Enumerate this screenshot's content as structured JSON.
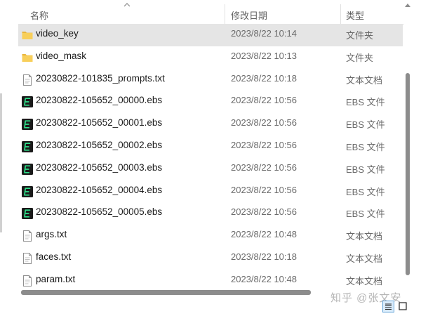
{
  "columns": {
    "name": "名称",
    "date": "修改日期",
    "type": "类型"
  },
  "sort": {
    "column": "name",
    "direction": "ascending"
  },
  "files": [
    {
      "icon": "folder-icon",
      "name": "video_key",
      "date": "2023/8/22 10:14",
      "type": "文件夹",
      "selected": true
    },
    {
      "icon": "folder-icon",
      "name": "video_mask",
      "date": "2023/8/22 10:13",
      "type": "文件夹",
      "selected": false
    },
    {
      "icon": "text-file-icon",
      "name": "20230822-101835_prompts.txt",
      "date": "2023/8/22 10:18",
      "type": "文本文档",
      "selected": false
    },
    {
      "icon": "ebs-file-icon",
      "name": "20230822-105652_00000.ebs",
      "date": "2023/8/22 10:56",
      "type": "EBS 文件",
      "selected": false
    },
    {
      "icon": "ebs-file-icon",
      "name": "20230822-105652_00001.ebs",
      "date": "2023/8/22 10:56",
      "type": "EBS 文件",
      "selected": false
    },
    {
      "icon": "ebs-file-icon",
      "name": "20230822-105652_00002.ebs",
      "date": "2023/8/22 10:56",
      "type": "EBS 文件",
      "selected": false
    },
    {
      "icon": "ebs-file-icon",
      "name": "20230822-105652_00003.ebs",
      "date": "2023/8/22 10:56",
      "type": "EBS 文件",
      "selected": false
    },
    {
      "icon": "ebs-file-icon",
      "name": "20230822-105652_00004.ebs",
      "date": "2023/8/22 10:56",
      "type": "EBS 文件",
      "selected": false
    },
    {
      "icon": "ebs-file-icon",
      "name": "20230822-105652_00005.ebs",
      "date": "2023/8/22 10:56",
      "type": "EBS 文件",
      "selected": false
    },
    {
      "icon": "text-file-icon",
      "name": "args.txt",
      "date": "2023/8/22 10:48",
      "type": "文本文档",
      "selected": false
    },
    {
      "icon": "text-file-icon",
      "name": "faces.txt",
      "date": "2023/8/22 10:18",
      "type": "文本文档",
      "selected": false
    },
    {
      "icon": "text-file-icon",
      "name": "param.txt",
      "date": "2023/8/22 10:48",
      "type": "文本文档",
      "selected": false
    }
  ],
  "watermark": "知乎 @张文安",
  "colors": {
    "selection": "#e5e5e5",
    "folder": "#f5c84c",
    "ebs_icon_bg": "#1a1a1a",
    "ebs_icon_fg": "#2fe08a",
    "view_active": "#6aa7da"
  },
  "view_buttons": [
    {
      "icon": "details-view-icon",
      "active": true
    },
    {
      "icon": "tiles-view-icon",
      "active": false
    }
  ]
}
